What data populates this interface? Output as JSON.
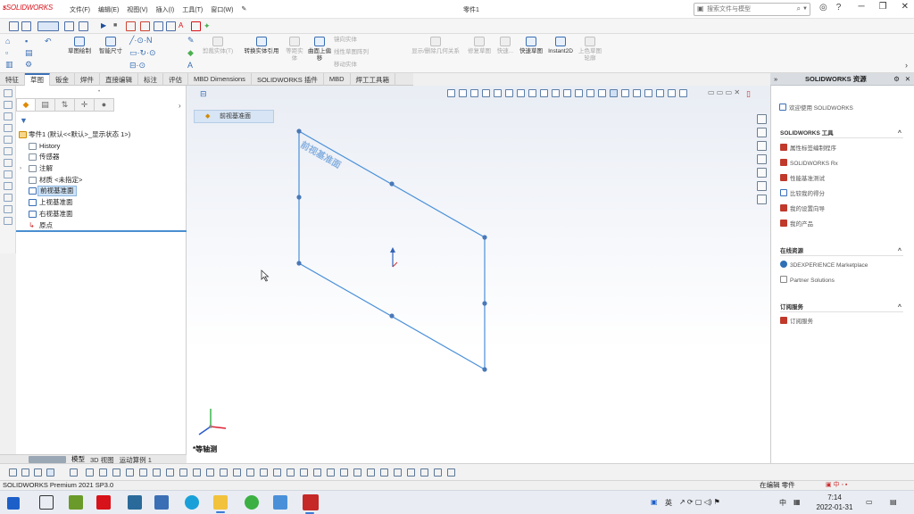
{
  "app": {
    "logo_brand": "SOLIDWORKS",
    "menu": [
      "文件(F)",
      "编辑(E)",
      "视图(V)",
      "插入(I)",
      "工具(T)",
      "窗口(W)"
    ],
    "document_title": "零件1",
    "search_placeholder": "搜索文件与模型"
  },
  "ribbon": {
    "buttons": [
      {
        "label": "草图绘制",
        "state": "enabled"
      },
      {
        "label": "智能尺寸",
        "state": "enabled"
      },
      {
        "label": "剪裁实体(T)",
        "state": "disabled"
      },
      {
        "label": "转换实体引用",
        "state": "enabled"
      },
      {
        "label": "等距实体",
        "state": "disabled"
      },
      {
        "label": "曲面上偏移",
        "state": "enabled"
      },
      {
        "label": "镜向实体",
        "state": "disabled"
      },
      {
        "label": "线性草图阵列",
        "state": "disabled"
      },
      {
        "label": "移动实体",
        "state": "disabled"
      },
      {
        "label": "显示/删除几何关系",
        "state": "disabled"
      },
      {
        "label": "修复草图",
        "state": "disabled"
      },
      {
        "label": "快速...",
        "state": "disabled"
      },
      {
        "label": "快速草图",
        "state": "enabled"
      },
      {
        "label": "Instant2D",
        "state": "enabled"
      },
      {
        "label": "上色草图轮廓",
        "state": "disabled"
      }
    ]
  },
  "cmd_tabs": [
    "特征",
    "草图",
    "钣金",
    "焊件",
    "直接编辑",
    "标注",
    "评估",
    "MBD Dimensions",
    "SOLIDWORKS 插件",
    "MBD",
    "焊工工具箱"
  ],
  "active_tab": "草图",
  "feature_tree": {
    "root": "零件1 (默认<<默认>_显示状态 1>)",
    "items": [
      {
        "label": "History",
        "selected": false
      },
      {
        "label": "传感器",
        "selected": false
      },
      {
        "label": "注解",
        "selected": false
      },
      {
        "label": "材质 <未指定>",
        "selected": false
      },
      {
        "label": "前视基准面",
        "selected": true
      },
      {
        "label": "上视基准面",
        "selected": false
      },
      {
        "label": "右视基准面",
        "selected": false
      },
      {
        "label": "原点",
        "selected": false
      }
    ]
  },
  "bottom_tabs": [
    "模型",
    "3D 视图",
    "运动算例 1"
  ],
  "viewport": {
    "selection_label": "前视基准面",
    "plane_label": "前视基准面",
    "view_label": "*等轴测"
  },
  "taskpane": {
    "title": "SOLIDWORKS 资源",
    "welcome": "欢迎使用 SOLIDWORKS",
    "tools_header": "SOLIDWORKS 工具",
    "tools": [
      "属性标签编制程序",
      "SOLIDWORKS Rx",
      "性能基准测试",
      "比较我的得分",
      "我的设置向导",
      "我的产品"
    ],
    "online_header": "在线资源",
    "online": [
      "3DEXPERIENCE Marketplace",
      "Partner Solutions"
    ],
    "subscription_header": "订阅服务",
    "subscription": [
      "订阅服务"
    ]
  },
  "status": {
    "version": "SOLIDWORKS Premium 2021 SP3.0",
    "mode": "在编辑 零件",
    "time": "7:14",
    "date": "2022-01-31"
  },
  "tray": {
    "ime1": "英",
    "ime2": "中"
  },
  "colors": {
    "accent": "#3a6fb5",
    "plane_edge": "#4a90d9",
    "brand_red": "#d8121a",
    "selection": "#cfe3f7"
  }
}
